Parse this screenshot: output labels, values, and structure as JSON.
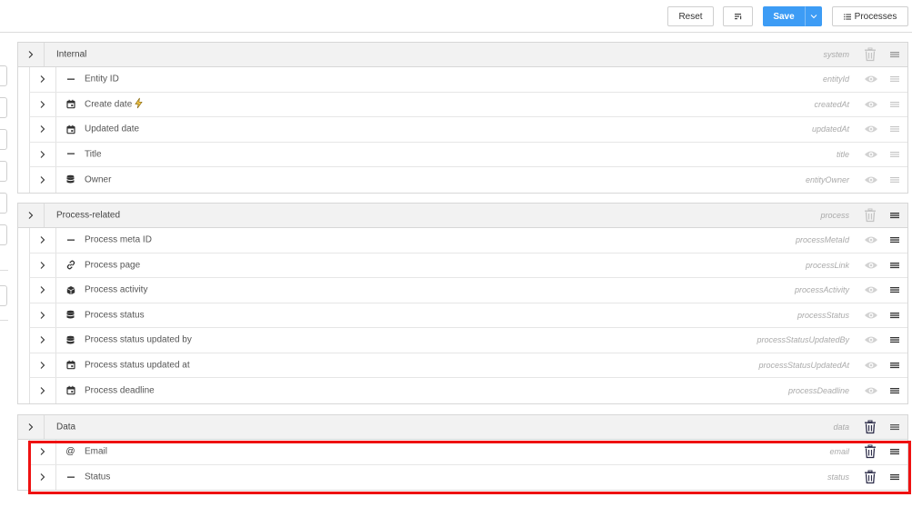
{
  "toolbar": {
    "reset_label": "Reset",
    "save_label": "Save",
    "processes_label": "Processes"
  },
  "colors": {
    "accent": "#3d9cf5",
    "highlight": "#ee1111",
    "icon_active": "#2d2d4a",
    "icon_disabled": "#c4c4c4"
  },
  "groups": [
    {
      "label": "Internal",
      "key": "system",
      "rows": [
        {
          "label": "Entity ID",
          "key": "entityId",
          "icon": "dash-icon"
        },
        {
          "label": "Create date",
          "key": "createdAt",
          "icon": "calendar-icon",
          "extra": "lightning-icon"
        },
        {
          "label": "Updated date",
          "key": "updatedAt",
          "icon": "calendar-icon"
        },
        {
          "label": "Title",
          "key": "title",
          "icon": "dash-icon"
        },
        {
          "label": "Owner",
          "key": "entityOwner",
          "icon": "database-icon"
        }
      ]
    },
    {
      "label": "Process-related",
      "key": "process",
      "rows": [
        {
          "label": "Process meta ID",
          "key": "processMetaId",
          "icon": "dash-icon"
        },
        {
          "label": "Process page",
          "key": "processLink",
          "icon": "link-icon"
        },
        {
          "label": "Process activity",
          "key": "processActivity",
          "icon": "cube-icon"
        },
        {
          "label": "Process status",
          "key": "processStatus",
          "icon": "database-icon"
        },
        {
          "label": "Process status updated by",
          "key": "processStatusUpdatedBy",
          "icon": "database-icon"
        },
        {
          "label": "Process status updated at",
          "key": "processStatusUpdatedAt",
          "icon": "calendar-icon"
        },
        {
          "label": "Process deadline",
          "key": "processDeadline",
          "icon": "calendar-icon"
        }
      ]
    },
    {
      "label": "Data",
      "key": "data",
      "rows": [
        {
          "label": "Email",
          "key": "email",
          "icon": "at-icon",
          "icon_text": "@"
        },
        {
          "label": "Status",
          "key": "status",
          "icon": "dash-icon"
        }
      ]
    }
  ]
}
